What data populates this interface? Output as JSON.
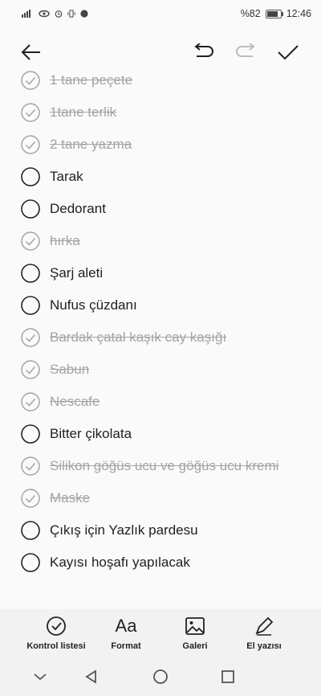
{
  "status": {
    "battery_text": "%82",
    "time": "12:46",
    "battery_level": 0.82
  },
  "toolbar": {
    "icons": [
      "back-arrow-icon",
      "undo-icon",
      "redo-icon",
      "confirm-check-icon"
    ]
  },
  "checklist": [
    {
      "text": "1 tane peçete",
      "done": true
    },
    {
      "text": "1tane terlik",
      "done": true
    },
    {
      "text": "2 tane yazma",
      "done": true
    },
    {
      "text": "Tarak",
      "done": false
    },
    {
      "text": "Dedorant",
      "done": false
    },
    {
      "text": " hırka",
      "done": true
    },
    {
      "text": "Şarj aleti",
      "done": false
    },
    {
      "text": "Nufus çüzdanı",
      "done": false
    },
    {
      "text": "Bardak çatal kaşık cay kaşığı",
      "done": true
    },
    {
      "text": "Sabun",
      "done": true
    },
    {
      "text": "Nescafe",
      "done": true
    },
    {
      "text": "Bitter çikolata",
      "done": false
    },
    {
      "text": "Silikon göğüs ucu ve göğüs ucu kremi",
      "done": true
    },
    {
      "text": "Maske",
      "done": true
    },
    {
      "text": "Çıkış için Yazlık pardesu",
      "done": false
    },
    {
      "text": "Kayısı hoşafı yapılacak",
      "done": false
    }
  ],
  "bottom_bar": {
    "checklist_label": "Kontrol listesi",
    "format_label": "Format",
    "format_glyph": "Aa",
    "gallery_label": "Galeri",
    "handwriting_label": "El yazısı"
  },
  "colors": {
    "done_text": "#a4a4a4",
    "text": "#1f1f1f",
    "background": "#fafafa"
  }
}
